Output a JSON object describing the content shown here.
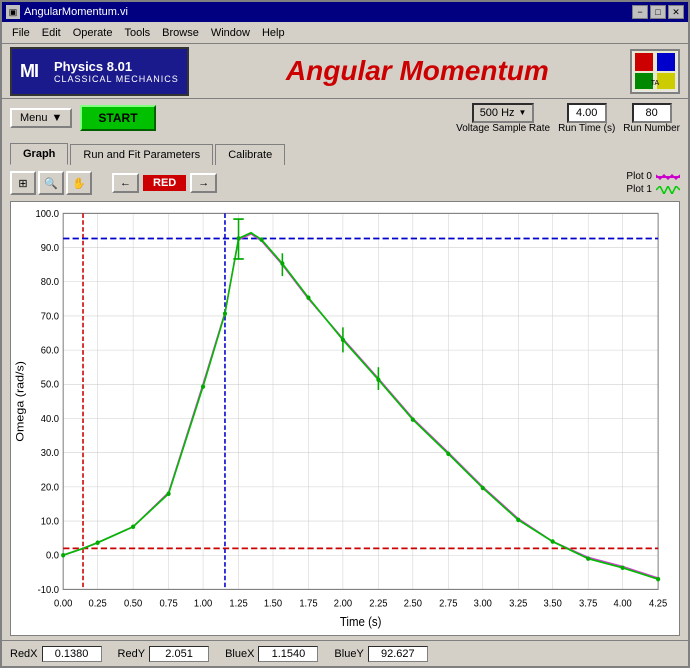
{
  "window": {
    "title": "AngularMomentum.vi",
    "title_btn_min": "−",
    "title_btn_max": "□",
    "title_btn_close": "✕"
  },
  "menu": {
    "items": [
      "File",
      "Edit",
      "Operate",
      "Tools",
      "Browse",
      "Window",
      "Help"
    ]
  },
  "header": {
    "mit_logo": "MI",
    "physics_name": "Physics 8.01",
    "physics_sub": "CLASSICAL MECHANICS",
    "title": "Angular Momentum"
  },
  "toolbar": {
    "menu_label": "Menu",
    "start_label": "START",
    "sample_rate_value": "500 Hz",
    "sample_rate_label": "Voltage Sample Rate",
    "run_time_value": "4.00",
    "run_time_label": "Run Time (s)",
    "run_number_value": "80",
    "run_number_label": "Run Number"
  },
  "tabs": {
    "items": [
      "Graph",
      "Run and Fit Parameters",
      "Calibrate"
    ],
    "active": 0
  },
  "graph": {
    "tool_buttons": [
      "⊞",
      "🔍",
      "✋"
    ],
    "cursor_left": "←",
    "cursor_label": "RED",
    "cursor_right": "→",
    "legend": [
      {
        "label": "Plot 0",
        "color": "#cc00cc"
      },
      {
        "label": "Plot 1",
        "color": "#00cc00"
      }
    ],
    "y_axis_label": "Omega (rad/s)",
    "x_axis_label": "Time (s)",
    "y_max": "100.0",
    "y_min": "-10.0",
    "x_min": "0.00",
    "x_max": "4.25",
    "y_ticks": [
      "-10.0",
      "0.0",
      "10.0",
      "20.0",
      "30.0",
      "40.0",
      "50.0",
      "60.0",
      "70.0",
      "80.0",
      "90.0",
      "100.0"
    ],
    "x_ticks": [
      "0.00",
      "0.25",
      "0.50",
      "0.75",
      "1.00",
      "1.25",
      "1.50",
      "1.75",
      "2.00",
      "2.25",
      "2.50",
      "2.75",
      "3.00",
      "3.25",
      "3.50",
      "3.75",
      "4.00",
      "4.25"
    ]
  },
  "status_bar": {
    "red_x_label": "RedX",
    "red_x_value": "0.1380",
    "red_y_label": "RedY",
    "red_y_value": "2.051",
    "blue_x_label": "BlueX",
    "blue_x_value": "1.1540",
    "blue_y_label": "BlueY",
    "blue_y_value": "92.627"
  }
}
